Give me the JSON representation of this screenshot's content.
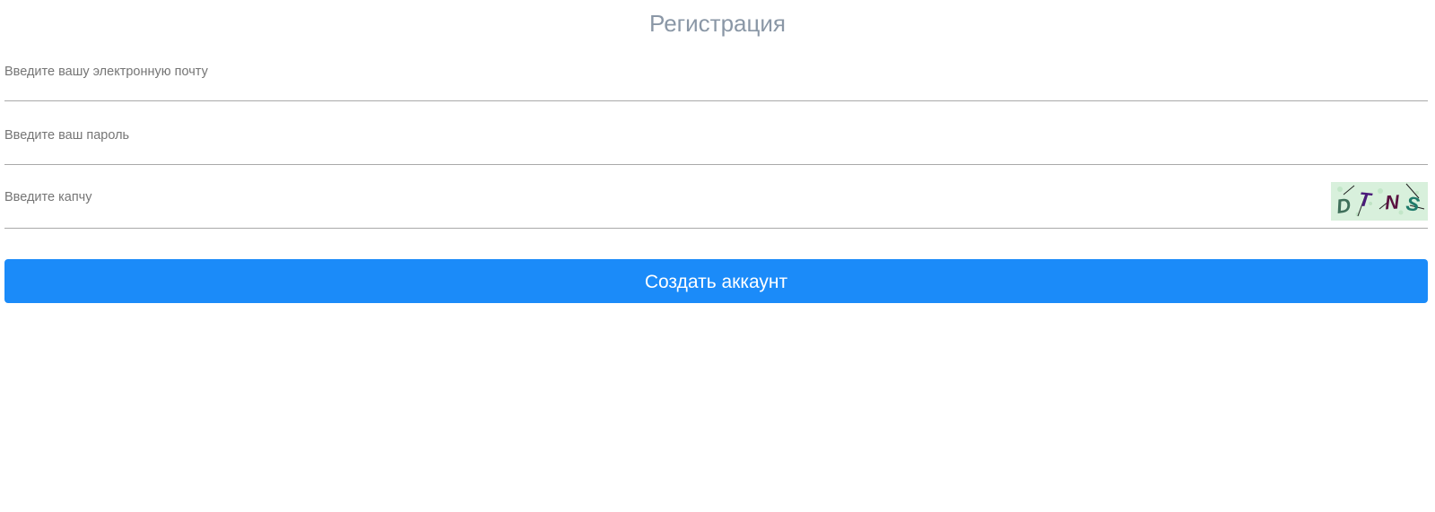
{
  "form": {
    "title": "Регистрация",
    "email": {
      "placeholder": "Введите вашу электронную почту",
      "value": ""
    },
    "password": {
      "placeholder": "Введите ваш пароль",
      "value": ""
    },
    "captcha": {
      "placeholder": "Введите капчу",
      "value": "",
      "image_text": [
        "D",
        "T",
        "N",
        "S"
      ],
      "image_colors": [
        "#3f6f5a",
        "#4a1a7a",
        "#5a1040",
        "#1f7a6a"
      ],
      "background": "#d8f0dc"
    },
    "submit_label": "Создать аккаунт",
    "accent_color": "#1b8bf9"
  }
}
